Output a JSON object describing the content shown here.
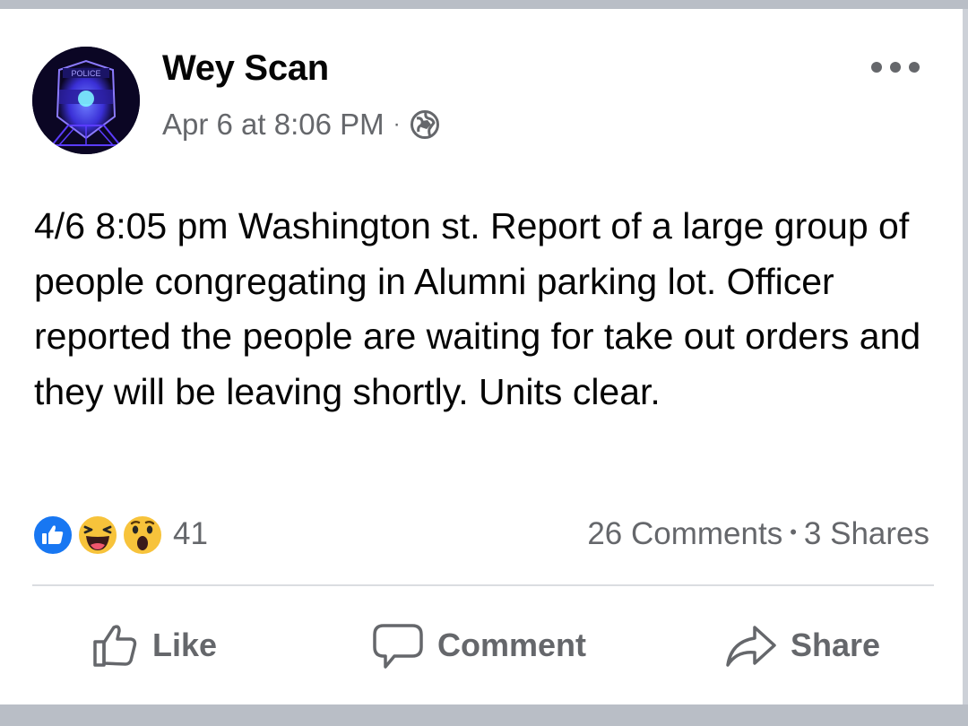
{
  "post": {
    "author": "Wey Scan",
    "timestamp": "Apr 6 at 8:06 PM",
    "meta_separator": "·",
    "privacy_icon": "globe-icon",
    "more_icon": "ellipsis-icon",
    "avatar_badge_text": "POLICE",
    "avatar_icon": "police-badge-icon",
    "text": "4/6 8:05 pm Washington st. Report of a large group of people congregating in Alumni parking lot. Officer reported the people are waiting for take out orders and they will be leaving shortly. Units clear."
  },
  "reactions": {
    "icons": [
      "like-reaction-icon",
      "haha-reaction-icon",
      "wow-reaction-icon"
    ],
    "count": "41"
  },
  "engagement": {
    "comments": "26 Comments",
    "separator": "•",
    "shares": "3 Shares"
  },
  "actions": {
    "like": "Like",
    "comment": "Comment",
    "share": "Share"
  },
  "colors": {
    "text_primary": "#050505",
    "text_secondary": "#65676b",
    "like_blue": "#1877f2",
    "reaction_yellow": "#f7c33b",
    "background_strip": "#b9bec6"
  }
}
